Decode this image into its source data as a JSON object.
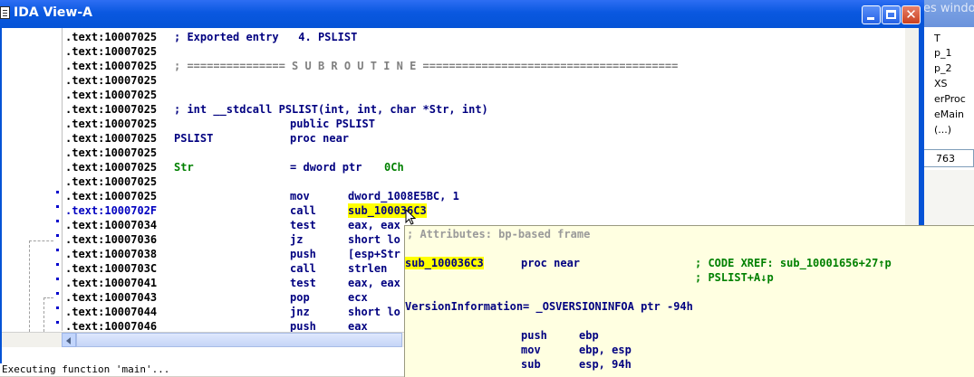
{
  "background_window": {
    "title_fragment": "es windo",
    "list_items": [
      "T",
      "p_1",
      "p_2",
      "XS",
      "erProc",
      "eMain",
      "(...)"
    ],
    "field_value": "763"
  },
  "window": {
    "title": "IDA View-A",
    "minimize_label": "",
    "maximize_label": "",
    "close_label": "✕"
  },
  "listing": [
    {
      "addr": ".text:10007025",
      "label": "",
      "op": "",
      "operand": "; Exported entry   4. PSLIST",
      "kind": "comment"
    },
    {
      "addr": ".text:10007025",
      "label": "",
      "op": "",
      "operand": "",
      "kind": "plain"
    },
    {
      "addr": ".text:10007025",
      "label": "",
      "op": "",
      "operand": "; =============== S U B R O U T I N E =======================================",
      "kind": "sep"
    },
    {
      "addr": ".text:10007025",
      "label": "",
      "op": "",
      "operand": "",
      "kind": "plain"
    },
    {
      "addr": ".text:10007025",
      "label": "",
      "op": "",
      "operand": "",
      "kind": "plain"
    },
    {
      "addr": ".text:10007025",
      "label": "",
      "op": "",
      "operand": "; int __stdcall PSLIST(int, int, char *Str, int)",
      "kind": "proto"
    },
    {
      "addr": ".text:10007025",
      "label": "",
      "op": "public PSLIST",
      "operand": "",
      "kind": "plain"
    },
    {
      "addr": ".text:10007025",
      "label": "PSLIST",
      "op": "proc near",
      "operand": "",
      "kind": "plain"
    },
    {
      "addr": ".text:10007025",
      "label": "",
      "op": "",
      "operand": "",
      "kind": "plain"
    },
    {
      "addr": ".text:10007025",
      "label": "Str",
      "op": "= dword ptr",
      "operand": "0Ch",
      "kind": "var"
    },
    {
      "addr": ".text:10007025",
      "label": "",
      "op": "",
      "operand": "",
      "kind": "plain"
    },
    {
      "addr": ".text:10007025",
      "label": "",
      "op": "mov",
      "operand": "dword_1008E5BC, 1",
      "kind": "code"
    },
    {
      "addr": ".text:1000702F",
      "label": "",
      "op": "call",
      "operand": "sub_100036C3",
      "kind": "call-hl"
    },
    {
      "addr": ".text:10007034",
      "label": "",
      "op": "test",
      "operand": "eax, eax",
      "kind": "code"
    },
    {
      "addr": ".text:10007036",
      "label": "",
      "op": "jz",
      "operand": "short lo",
      "kind": "code"
    },
    {
      "addr": ".text:10007038",
      "label": "",
      "op": "push",
      "operand": "[esp+Str",
      "kind": "code"
    },
    {
      "addr": ".text:1000703C",
      "label": "",
      "op": "call",
      "operand": "strlen",
      "kind": "code"
    },
    {
      "addr": ".text:10007041",
      "label": "",
      "op": "test",
      "operand": "eax, eax",
      "kind": "code"
    },
    {
      "addr": ".text:10007043",
      "label": "",
      "op": "pop",
      "operand": "ecx",
      "kind": "code"
    },
    {
      "addr": ".text:10007044",
      "label": "",
      "op": "jnz",
      "operand": "short lo",
      "kind": "code"
    },
    {
      "addr": ".text:10007046",
      "label": "",
      "op": "push",
      "operand": "eax",
      "kind": "code"
    }
  ],
  "hint": {
    "attributes": "; Attributes: bp-based frame",
    "sub_name": "sub_100036C3",
    "sub_op": "proc near",
    "xref1": "; CODE XREF: sub_10001656+27↑p",
    "xref2": "; PSLIST+A↓p",
    "version_line": "VersionInformation= _OSVERSIONINFOA ptr -94h",
    "code": [
      {
        "op": "push",
        "operand": "ebp"
      },
      {
        "op": "mov",
        "operand": "ebp, esp"
      },
      {
        "op": "sub",
        "operand": "esp, 94h"
      }
    ]
  },
  "status": {
    "text": "Executing function 'main'..."
  },
  "colors": {
    "title_bar": "#0553d6",
    "code_text": "#000080",
    "comment": "#808080",
    "highlight": "#ffff00",
    "hint_bg": "#ffffe1",
    "label_green": "#008000"
  }
}
